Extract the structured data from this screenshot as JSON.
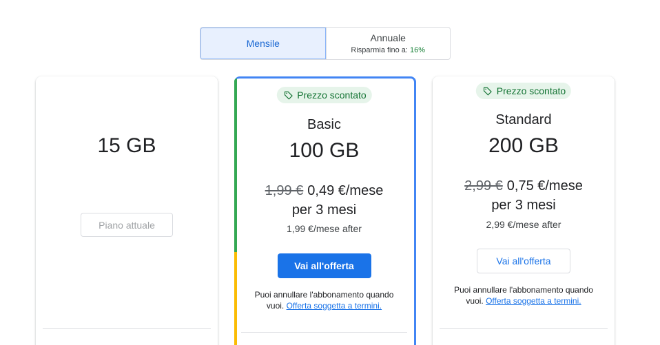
{
  "billing_toggle": {
    "monthly_label": "Mensile",
    "annual_label": "Annuale",
    "annual_savings_prefix": "Risparmia fino a:",
    "annual_savings_pct": "16%"
  },
  "plans": [
    {
      "storage": "15 GB",
      "button_label": "Piano attuale"
    },
    {
      "badge": "Prezzo scontato",
      "name": "Basic",
      "storage": "100 GB",
      "old_price": "1,99 €",
      "new_price": "0,49 €/mese",
      "period": "per 3 mesi",
      "after": "1,99 €/mese after",
      "button_label": "Vai all'offerta",
      "cancel_text": "Puoi annullare l'abbonamento quando vuoi.",
      "terms_link": "Offerta soggetta a termini."
    },
    {
      "badge": "Prezzo scontato",
      "name": "Standard",
      "storage": "200 GB",
      "old_price": "2,99 €",
      "new_price": "0,75 €/mese",
      "period": "per 3 mesi",
      "after": "2,99 €/mese after",
      "button_label": "Vai all'offerta",
      "cancel_text": "Puoi annullare l'abbonamento quando vuoi.",
      "terms_link": "Offerta soggetta a termini."
    }
  ],
  "colors": {
    "accent": "#1a73e8",
    "badge_bg": "#e6f4ea",
    "badge_text": "#137333",
    "highlight_border": "#4285f4",
    "bar_green": "#34a853",
    "bar_yellow": "#fbbc04"
  },
  "icons": {
    "badge_icon": "tag-icon"
  }
}
